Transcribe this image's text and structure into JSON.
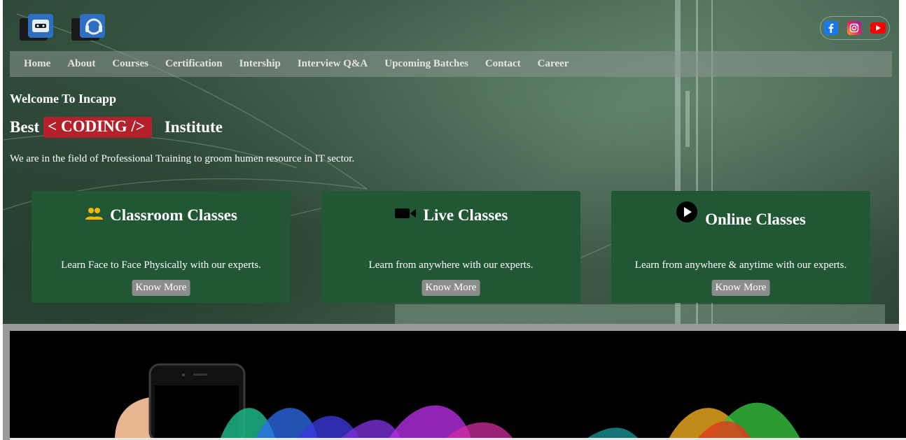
{
  "brand": {
    "logo_icons": [
      "robot-badge-icon",
      "headset-badge-icon"
    ]
  },
  "social": [
    {
      "name": "facebook-icon",
      "color": "#1877f2"
    },
    {
      "name": "instagram-icon",
      "color": "#e91e63"
    },
    {
      "name": "youtube-icon",
      "color": "#ff0000"
    }
  ],
  "nav": {
    "items": [
      "Home",
      "About",
      "Courses",
      "Certification",
      "Intership",
      "Interview Q&A",
      "Upcoming Batches",
      "Contact",
      "Career"
    ]
  },
  "hero": {
    "welcome": "Welcome To Incapp",
    "best": "Best",
    "coding": "< CODING />",
    "institute": "Institute",
    "tagline": "We are in the field of Professional Training to groom humen resource in IT sector."
  },
  "cards": [
    {
      "icon": "users-icon",
      "title": "Classroom Classes",
      "text": "Learn Face to Face Physically with our experts.",
      "button": "Know More"
    },
    {
      "icon": "video-camera-icon",
      "title": "Live Classes",
      "text": "Learn from anywhere with our experts.",
      "button": "Know More"
    },
    {
      "icon": "play-circle-icon",
      "title": "Online Classes",
      "text": "Learn from anywhere & anytime with our experts.",
      "button": "Know More"
    }
  ],
  "colors": {
    "nav_bg": "#8c9691",
    "badge_red": "#b5202a",
    "card_green": "#215735",
    "button_grey": "#8c8c8c"
  }
}
